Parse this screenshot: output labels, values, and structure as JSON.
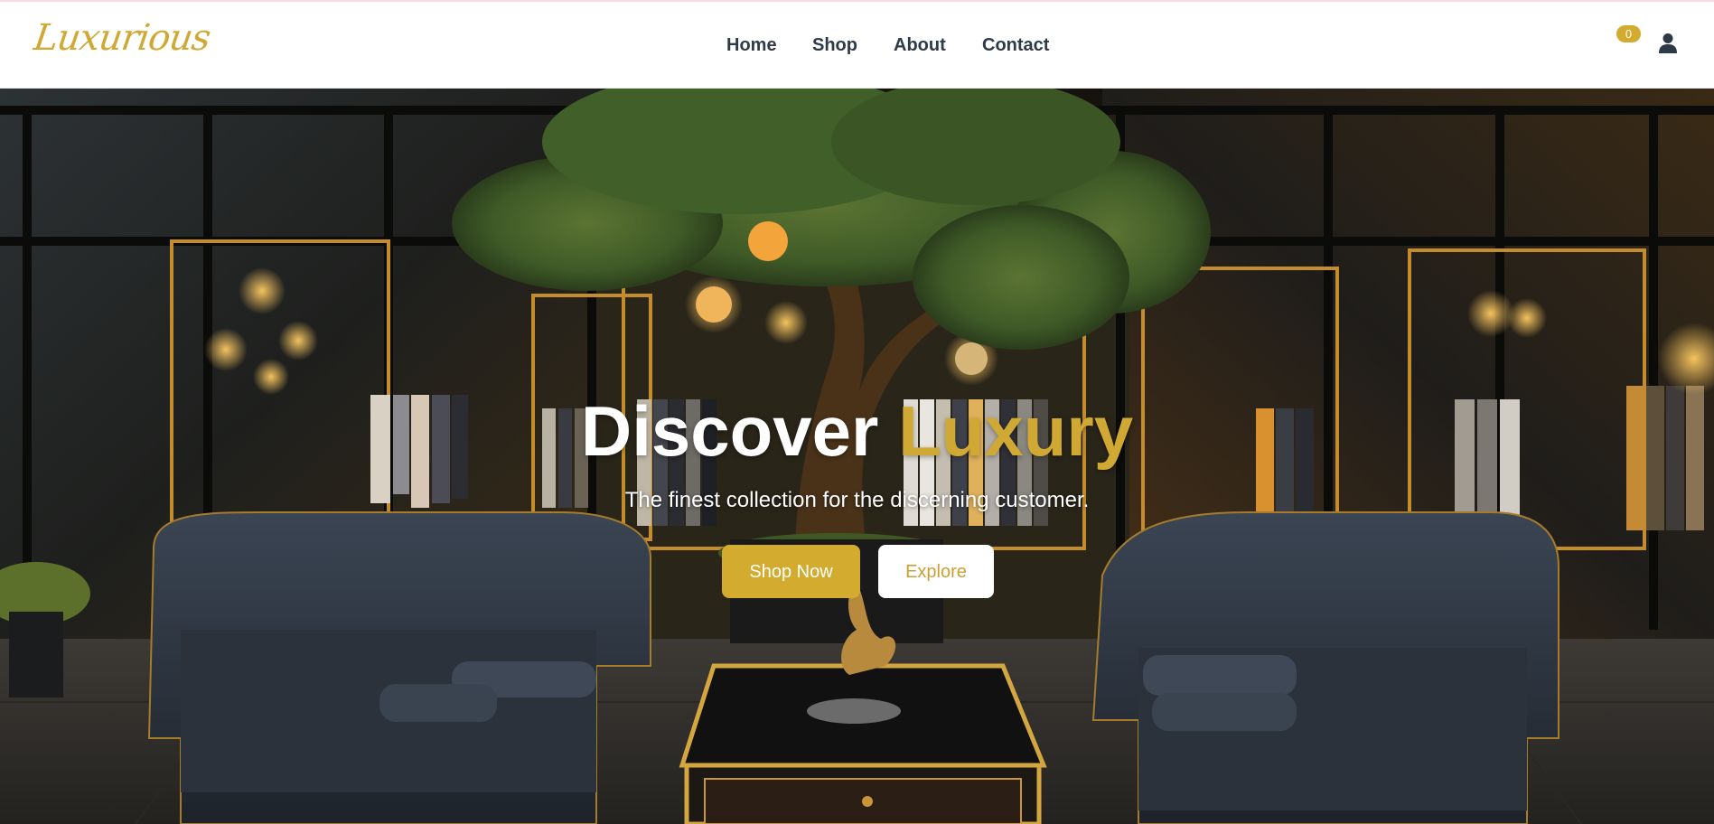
{
  "brand": {
    "logo_text": "Luxurious",
    "accent_color": "#d0a934"
  },
  "nav": {
    "items": [
      {
        "label": "Home"
      },
      {
        "label": "Shop"
      },
      {
        "label": "About"
      },
      {
        "label": "Contact"
      }
    ]
  },
  "header_actions": {
    "cart_icon": "shopping-cart-icon",
    "cart_count": "0",
    "user_icon": "user-icon"
  },
  "hero": {
    "title_part1": "Discover",
    "title_part2": "Luxury",
    "subtitle": "The finest collection for the discerning customer.",
    "primary_button": "Shop Now",
    "secondary_button": "Explore",
    "background_image": "luxury-boutique-interior-with-tree-and-leather-sofas"
  }
}
